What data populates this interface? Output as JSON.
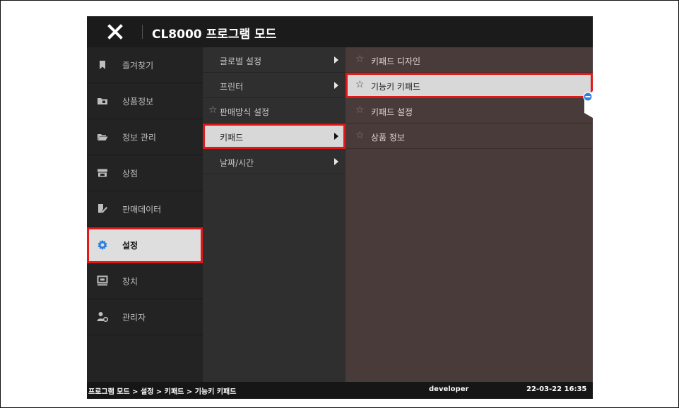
{
  "window": {
    "title": "CL8000 프로그램 모드"
  },
  "sidebar": {
    "items": [
      {
        "label": "즐겨찾기",
        "icon": "bookmark-icon"
      },
      {
        "label": "상품정보",
        "icon": "folder-box-icon"
      },
      {
        "label": "정보 관리",
        "icon": "open-folder-icon"
      },
      {
        "label": "상점",
        "icon": "store-icon"
      },
      {
        "label": "판매데이터",
        "icon": "edit-document-icon"
      },
      {
        "label": "설정",
        "icon": "gear-icon",
        "active": true
      },
      {
        "label": "장치",
        "icon": "monitor-icon"
      },
      {
        "label": "관리자",
        "icon": "user-gear-icon"
      }
    ]
  },
  "settings_menu": {
    "items": [
      {
        "label": "글로벌 설정",
        "has_submenu": true
      },
      {
        "label": "프린터",
        "has_submenu": true
      },
      {
        "label": "판매방식 설정",
        "has_submenu": false,
        "starred": true
      },
      {
        "label": "키패드",
        "has_submenu": true,
        "selected": true
      },
      {
        "label": "날짜/시간",
        "has_submenu": true
      }
    ]
  },
  "keypad_submenu": {
    "items": [
      {
        "label": "키패드 디자인",
        "icon": "star-outline-icon"
      },
      {
        "label": "기능키 키패드",
        "icon": "star-outline-icon",
        "selected": true
      },
      {
        "label": "키패드 설정",
        "icon": "star-outline-icon"
      },
      {
        "label": "상품 정보",
        "icon": "star-outline-icon"
      }
    ]
  },
  "status_bar": {
    "path": "프로그램 모드 > 설정 > 키패드 > 기능키 키패드",
    "user": "developer",
    "datetime": "22-03-22 16:35"
  },
  "colors": {
    "highlight_border": "#e01818",
    "selected_bg": "#d8d8d8",
    "submenu_bg": "#4a3b3b",
    "accent_blue": "#2f7fe0"
  }
}
